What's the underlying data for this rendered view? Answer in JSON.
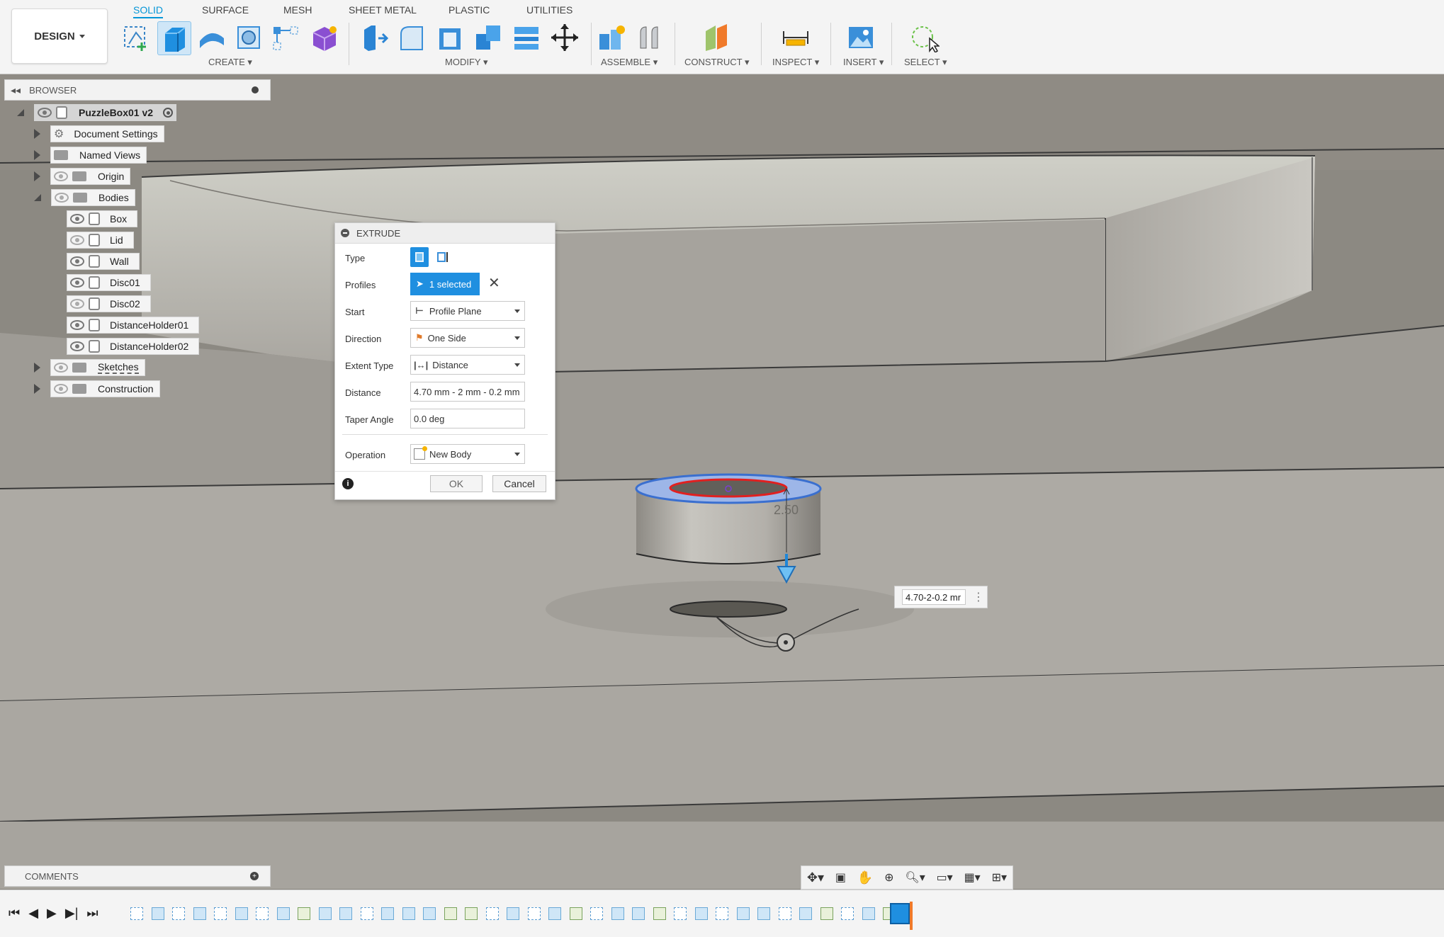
{
  "toolbar": {
    "workspace": "DESIGN",
    "tabs": [
      "SOLID",
      "SURFACE",
      "MESH",
      "SHEET METAL",
      "PLASTIC",
      "UTILITIES"
    ],
    "active_tab": "SOLID",
    "groups": [
      "CREATE",
      "MODIFY",
      "ASSEMBLE",
      "CONSTRUCT",
      "INSPECT",
      "INSERT",
      "SELECT"
    ]
  },
  "browser": {
    "title": "BROWSER",
    "root": "PuzzleBox01 v2",
    "items": {
      "document_settings": "Document Settings",
      "named_views": "Named Views",
      "origin": "Origin",
      "bodies": "Bodies",
      "sketches": "Sketches",
      "construction": "Construction"
    },
    "bodies": [
      "Box",
      "Lid",
      "Wall",
      "Disc01",
      "Disc02",
      "DistanceHolder01",
      "DistanceHolder02"
    ]
  },
  "extrude": {
    "title": "EXTRUDE",
    "labels": {
      "type": "Type",
      "profiles": "Profiles",
      "start": "Start",
      "direction": "Direction",
      "extent_type": "Extent Type",
      "distance": "Distance",
      "taper_angle": "Taper Angle",
      "operation": "Operation"
    },
    "values": {
      "profiles": "1 selected",
      "start": "Profile Plane",
      "direction": "One Side",
      "extent_type": "Distance",
      "distance": "4.70 mm - 2 mm - 0.2 mm",
      "taper_angle": "0.0 deg",
      "operation": "New Body"
    },
    "ok": "OK",
    "cancel": "Cancel"
  },
  "viewport": {
    "dimension_label": "2.50",
    "distance_input": "4.70-2-0.2 mr"
  },
  "comments": {
    "title": "COMMENTS"
  },
  "colors": {
    "accent": "#0696d7",
    "selection_blue": "#4a7fd6",
    "profile_red": "#e02020"
  }
}
